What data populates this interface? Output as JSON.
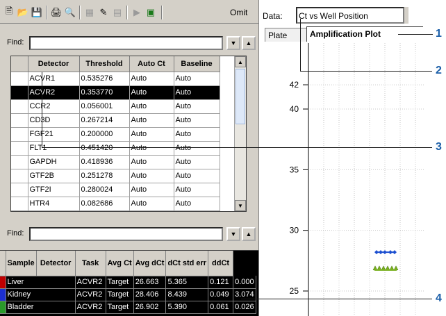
{
  "toolbar": {
    "buttons": [
      "new-icon",
      "open-icon",
      "save-icon",
      "print-icon",
      "print-preview-icon",
      "group-icon",
      "edit-icon",
      "grid-icon",
      "play-icon",
      "export-icon"
    ],
    "omit_label": "Omit"
  },
  "find_top": {
    "label": "Find:",
    "value": ""
  },
  "detector_table": {
    "columns": [
      "Detector",
      "Threshold",
      "Auto Ct",
      "Baseline"
    ],
    "rows": [
      [
        "ACVR1",
        "0.535276",
        "Auto",
        "Auto"
      ],
      [
        "ACVR2",
        "0.353770",
        "Auto",
        "Auto"
      ],
      [
        "CCR2",
        "0.056001",
        "Auto",
        "Auto"
      ],
      [
        "CD3D",
        "0.267214",
        "Auto",
        "Auto"
      ],
      [
        "FGF21",
        "0.200000",
        "Auto",
        "Auto"
      ],
      [
        "FLT1",
        "0.451420",
        "Auto",
        "Auto"
      ],
      [
        "GAPDH",
        "0.418936",
        "Auto",
        "Auto"
      ],
      [
        "GTF2B",
        "0.251278",
        "Auto",
        "Auto"
      ],
      [
        "GTF2I",
        "0.280024",
        "Auto",
        "Auto"
      ],
      [
        "HTR4",
        "0.082686",
        "Auto",
        "Auto"
      ]
    ],
    "selected_index": 1
  },
  "find_bottom": {
    "label": "Find:",
    "value": ""
  },
  "sample_table": {
    "columns": [
      "Sample",
      "Detector",
      "Task",
      "Avg Ct",
      "Avg dCt",
      "dCt std err",
      "ddCt"
    ],
    "rows": [
      {
        "color": "#c00000",
        "cells": [
          "Liver",
          "ACVR2",
          "Target",
          "26.663",
          "5.365",
          "0.121",
          "0.000"
        ]
      },
      {
        "color": "#1c2fd0",
        "cells": [
          "Kidney",
          "ACVR2",
          "Target",
          "28.406",
          "8.439",
          "0.049",
          "3.074"
        ]
      },
      {
        "color": "#2a9a2a",
        "cells": [
          "Bladder",
          "ACVR2",
          "Target",
          "26.902",
          "5.390",
          "0.061",
          "0.026"
        ]
      }
    ]
  },
  "data_selector": {
    "label": "Data:",
    "value": "Ct vs Well Position"
  },
  "tabs": [
    "Plate",
    "Amplification Plot"
  ],
  "active_tab": "Amplification Plot",
  "plot": {
    "y_ticks": [
      "42",
      "40",
      "35",
      "30",
      "25"
    ],
    "marker_colors": {
      "blue": "#1c4fd0",
      "green": "#7ab020"
    }
  },
  "callouts": [
    "1",
    "2",
    "3",
    "4"
  ]
}
